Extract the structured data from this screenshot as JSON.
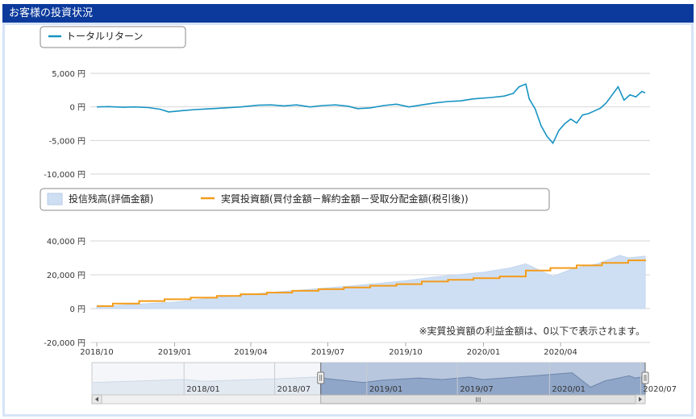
{
  "panel_title": "お客様の投資状況",
  "note": "※実質投資額の利益金額は、0以下で表示されます。",
  "colors": {
    "header": "#0b3a9c",
    "return_line": "#1793c2",
    "balance_area": "#cfdff3",
    "invested_line": "#f39c1a",
    "navigator_fill": "#8fa6c8"
  },
  "chart_data": [
    {
      "type": "line",
      "legend": [
        "トータルリターン"
      ],
      "y_ticks": [
        "5,000 円",
        "0 円",
        "-5,000 円",
        "-10,000 円"
      ],
      "ylim": [
        -10000,
        5000
      ],
      "x_range": [
        "2018-10-01",
        "2020-07-10"
      ],
      "series": [
        {
          "name": "トータルリターン",
          "points": [
            [
              "2018-10-01",
              0
            ],
            [
              "2018-10-15",
              50
            ],
            [
              "2018-11-01",
              -50
            ],
            [
              "2018-11-15",
              0
            ],
            [
              "2018-12-01",
              -100
            ],
            [
              "2018-12-15",
              -350
            ],
            [
              "2018-12-25",
              -750
            ],
            [
              "2019-01-10",
              -550
            ],
            [
              "2019-01-25",
              -400
            ],
            [
              "2019-02-15",
              -250
            ],
            [
              "2019-03-01",
              -150
            ],
            [
              "2019-03-20",
              0
            ],
            [
              "2019-04-10",
              250
            ],
            [
              "2019-04-25",
              300
            ],
            [
              "2019-05-10",
              150
            ],
            [
              "2019-05-25",
              300
            ],
            [
              "2019-06-10",
              0
            ],
            [
              "2019-06-25",
              200
            ],
            [
              "2019-07-10",
              300
            ],
            [
              "2019-07-25",
              100
            ],
            [
              "2019-08-05",
              -250
            ],
            [
              "2019-08-20",
              -150
            ],
            [
              "2019-09-05",
              200
            ],
            [
              "2019-09-20",
              400
            ],
            [
              "2019-10-05",
              0
            ],
            [
              "2019-10-20",
              300
            ],
            [
              "2019-11-05",
              600
            ],
            [
              "2019-11-20",
              800
            ],
            [
              "2019-12-05",
              900
            ],
            [
              "2019-12-20",
              1200
            ],
            [
              "2020-01-10",
              1400
            ],
            [
              "2020-01-25",
              1600
            ],
            [
              "2020-02-05",
              2000
            ],
            [
              "2020-02-12",
              3000
            ],
            [
              "2020-02-20",
              3400
            ],
            [
              "2020-02-24",
              1200
            ],
            [
              "2020-03-02",
              -300
            ],
            [
              "2020-03-09",
              -2800
            ],
            [
              "2020-03-16",
              -4400
            ],
            [
              "2020-03-23",
              -5400
            ],
            [
              "2020-03-30",
              -3500
            ],
            [
              "2020-04-06",
              -2500
            ],
            [
              "2020-04-13",
              -1800
            ],
            [
              "2020-04-20",
              -2400
            ],
            [
              "2020-04-27",
              -1200
            ],
            [
              "2020-05-04",
              -1000
            ],
            [
              "2020-05-11",
              -600
            ],
            [
              "2020-05-18",
              -200
            ],
            [
              "2020-05-25",
              600
            ],
            [
              "2020-06-01",
              1800
            ],
            [
              "2020-06-08",
              3000
            ],
            [
              "2020-06-15",
              1000
            ],
            [
              "2020-06-22",
              1800
            ],
            [
              "2020-06-29",
              1500
            ],
            [
              "2020-07-06",
              2300
            ],
            [
              "2020-07-10",
              2100
            ]
          ]
        }
      ]
    },
    {
      "type": "area",
      "legend": [
        "投信残高(評価金額)",
        "実質投資額(買付金額－解約金額－受取分配金額(税引後))"
      ],
      "y_ticks": [
        "40,000 円",
        "20,000 円",
        "0 円",
        "-20,000 円"
      ],
      "ylim": [
        -20000,
        40000
      ],
      "x_ticks": [
        "2018/10",
        "2019/01",
        "2019/04",
        "2019/07",
        "2019/10",
        "2020/01",
        "2020/04"
      ],
      "x_tick_dates": [
        "2018-10-01",
        "2019-01-01",
        "2019-04-01",
        "2019-07-01",
        "2019-10-01",
        "2020-01-01",
        "2020-04-01"
      ],
      "x_range": [
        "2018-10-01",
        "2020-07-10"
      ],
      "series": [
        {
          "name": "投信残高(評価金額)",
          "points": [
            [
              "2018-10-01",
              1000
            ],
            [
              "2018-11-01",
              2000
            ],
            [
              "2018-12-01",
              3000
            ],
            [
              "2019-01-01",
              3800
            ],
            [
              "2019-02-01",
              5500
            ],
            [
              "2019-03-01",
              7000
            ],
            [
              "2019-04-01",
              8500
            ],
            [
              "2019-05-01",
              9800
            ],
            [
              "2019-06-01",
              11000
            ],
            [
              "2019-07-01",
              12300
            ],
            [
              "2019-08-01",
              13500
            ],
            [
              "2019-09-01",
              15000
            ],
            [
              "2019-10-01",
              16500
            ],
            [
              "2019-11-01",
              18500
            ],
            [
              "2019-12-01",
              20000
            ],
            [
              "2020-01-01",
              21500
            ],
            [
              "2020-02-01",
              24000
            ],
            [
              "2020-02-20",
              26500
            ],
            [
              "2020-03-10",
              22000
            ],
            [
              "2020-03-23",
              19000
            ],
            [
              "2020-04-15",
              23500
            ],
            [
              "2020-05-15",
              26500
            ],
            [
              "2020-06-10",
              31500
            ],
            [
              "2020-06-20",
              30000
            ],
            [
              "2020-07-10",
              31000
            ]
          ]
        },
        {
          "name": "実質投資額(買付金額－解約金額－受取分配金額(税引後))",
          "steps": [
            [
              "2018-10-01",
              1500
            ],
            [
              "2018-10-20",
              3000
            ],
            [
              "2018-11-20",
              4500
            ],
            [
              "2018-12-20",
              5500
            ],
            [
              "2019-01-20",
              6500
            ],
            [
              "2019-02-20",
              7500
            ],
            [
              "2019-03-20",
              8500
            ],
            [
              "2019-04-20",
              9500
            ],
            [
              "2019-05-20",
              10500
            ],
            [
              "2019-06-20",
              11500
            ],
            [
              "2019-07-20",
              12500
            ],
            [
              "2019-08-20",
              13500
            ],
            [
              "2019-09-20",
              14500
            ],
            [
              "2019-10-20",
              16000
            ],
            [
              "2019-11-20",
              17000
            ],
            [
              "2019-12-20",
              18000
            ],
            [
              "2020-01-20",
              19000
            ],
            [
              "2020-02-20",
              22500
            ],
            [
              "2020-03-20",
              24000
            ],
            [
              "2020-04-20",
              25500
            ],
            [
              "2020-05-20",
              27000
            ],
            [
              "2020-06-20",
              28500
            ],
            [
              "2020-07-10",
              29000
            ]
          ]
        }
      ]
    },
    {
      "type": "area",
      "role": "range-navigator",
      "x_ticks": [
        "2018/01",
        "2018/07",
        "2019/01",
        "2019/07",
        "2020/01",
        "2020/07"
      ],
      "x_tick_dates": [
        "2018-01-01",
        "2018-07-01",
        "2019-01-01",
        "2019-07-01",
        "2020-01-01",
        "2020-07-01"
      ],
      "x_range": [
        "2017-07-01",
        "2020-07-10"
      ],
      "selected_range": [
        "2018-10-01",
        "2020-07-10"
      ],
      "series": [
        {
          "name": "",
          "points": [
            [
              "2017-07-01",
              40
            ],
            [
              "2017-10-01",
              45
            ],
            [
              "2018-01-01",
              50
            ],
            [
              "2018-02-10",
              44
            ],
            [
              "2018-04-01",
              47
            ],
            [
              "2018-07-01",
              52
            ],
            [
              "2018-09-20",
              58
            ],
            [
              "2018-10-01",
              55
            ],
            [
              "2018-12-25",
              40
            ],
            [
              "2019-02-01",
              48
            ],
            [
              "2019-04-15",
              55
            ],
            [
              "2019-06-01",
              50
            ],
            [
              "2019-07-25",
              58
            ],
            [
              "2019-08-20",
              50
            ],
            [
              "2019-10-01",
              55
            ],
            [
              "2019-12-01",
              62
            ],
            [
              "2020-02-15",
              72
            ],
            [
              "2020-03-23",
              25
            ],
            [
              "2020-04-20",
              45
            ],
            [
              "2020-06-08",
              62
            ],
            [
              "2020-06-20",
              55
            ],
            [
              "2020-07-10",
              60
            ]
          ]
        }
      ]
    }
  ]
}
